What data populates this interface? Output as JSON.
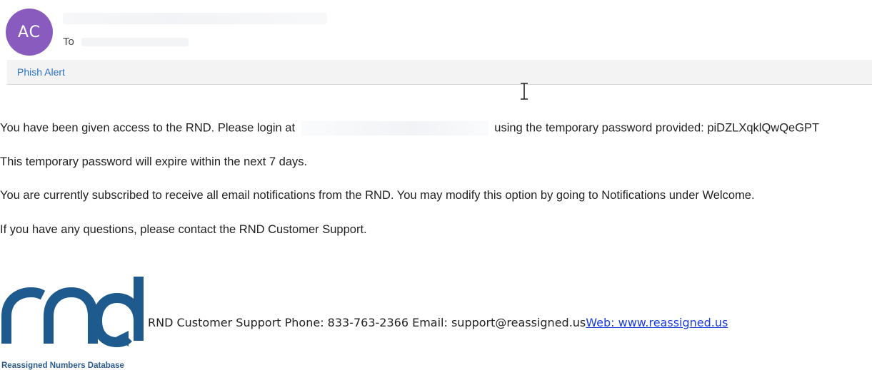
{
  "header": {
    "avatar_initials": "AC",
    "to_label": "To"
  },
  "toolbar": {
    "phish_alert_label": "Phish Alert"
  },
  "body": {
    "p1_before": "You have been given access to the RND. Please login at",
    "p1_after": "using the temporary password provided: piDZLXqklQwQeGPT",
    "p2": "This temporary password will expire within the next 7 days.",
    "p3": "You are currently subscribed to receive all email notifications from the RND. You may modify this option by going to Notifications under Welcome.",
    "p4": "If you have any questions, please contact the RND Customer Support."
  },
  "signature": {
    "logo_text": "rnd",
    "logo_caption": "Reassigned Numbers Database",
    "text": "RND Customer Support Phone: 833-763-2366 Email: support@reassigned.us",
    "web_link": "Web: www.reassigned.us"
  },
  "colors": {
    "avatar": "#8a5bbf",
    "link": "#2a73c5",
    "logo": "#1f5a8f"
  }
}
